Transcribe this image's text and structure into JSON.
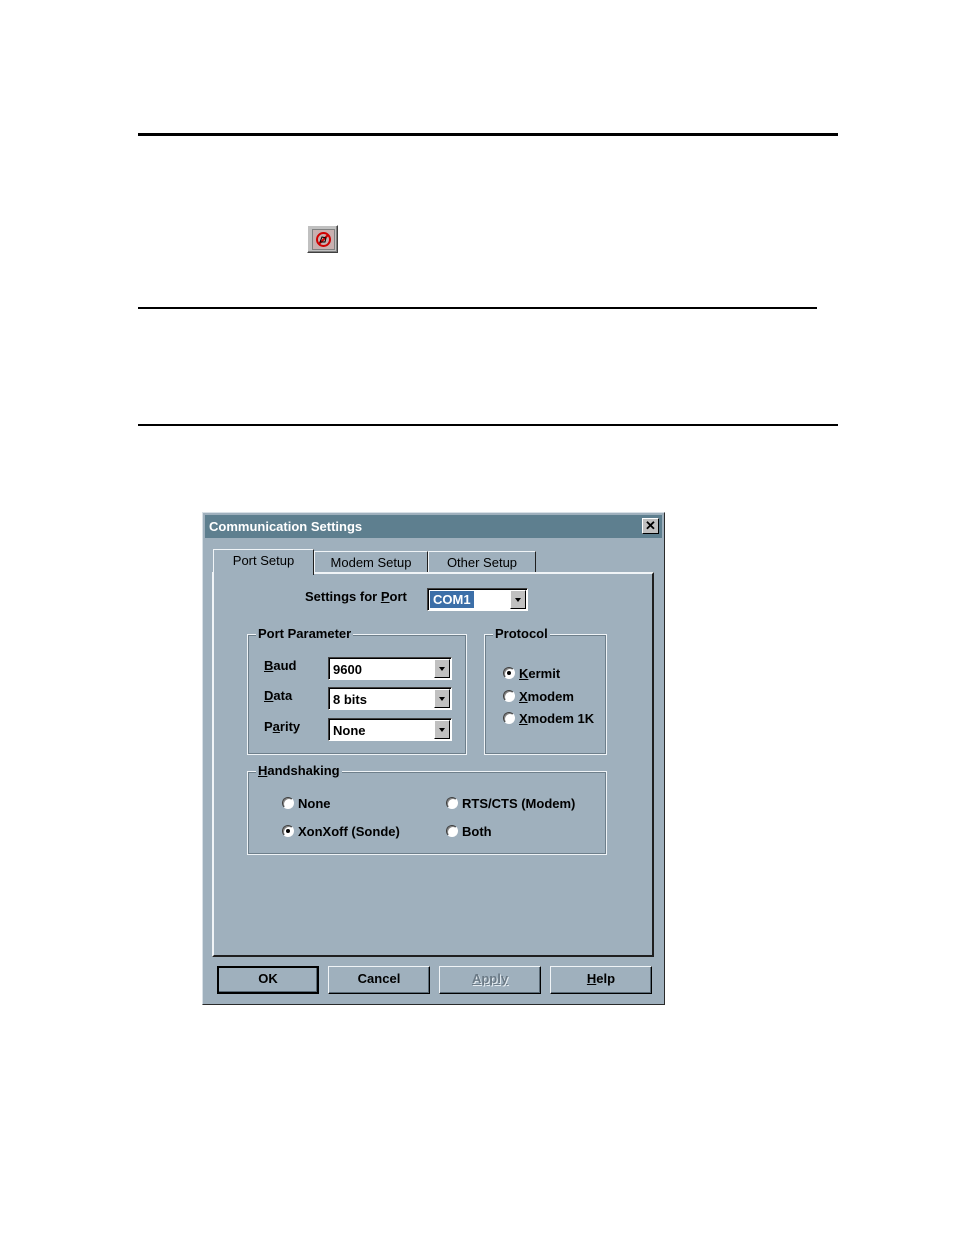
{
  "dialog": {
    "title": "Communication Settings",
    "close_glyph": "✕",
    "tabs": [
      "Port Setup",
      "Modem Setup",
      "Other Setup"
    ],
    "port": {
      "label_pre": "Settings for ",
      "label_key": "P",
      "label_post": "ort",
      "value": "COM1"
    },
    "port_parameter": {
      "title": "Port Parameter",
      "baud": {
        "key": "B",
        "rest": "aud",
        "value": "9600"
      },
      "data": {
        "key": "D",
        "rest": "ata",
        "value": "8 bits"
      },
      "parity": {
        "pre": "P",
        "key": "a",
        "rest": "rity",
        "value": "None"
      }
    },
    "protocol": {
      "title": "Protocol",
      "options": [
        {
          "key": "K",
          "rest": "ermit",
          "selected": true
        },
        {
          "key": "X",
          "rest": "modem",
          "selected": false
        },
        {
          "key": "X",
          "rest": "modem 1K",
          "selected": false
        }
      ]
    },
    "handshaking": {
      "title_key": "H",
      "title_rest": "andshaking",
      "none": "None",
      "rtscts": "RTS/CTS (Modem)",
      "xonxoff": "XonXoff (Sonde)",
      "both": "Both",
      "selected": "XonXoff (Sonde)"
    },
    "buttons": {
      "ok": "OK",
      "cancel": "Cancel",
      "apply": "Apply",
      "help_key": "H",
      "help_rest": "elp"
    }
  }
}
